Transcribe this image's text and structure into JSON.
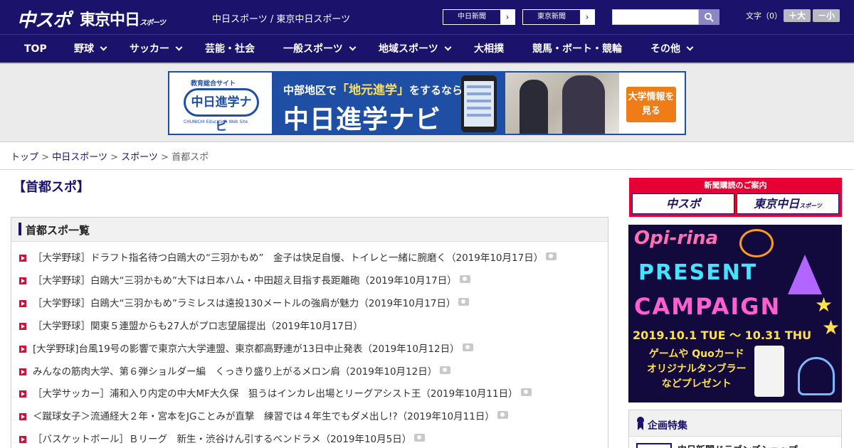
{
  "header": {
    "logo_chuspo": "中スポ",
    "logo_tokyo": "東京中日",
    "logo_tokyo_suffix": "スポーツ",
    "site_title": "中日スポーツ / 東京中日スポーツ",
    "paper_links": [
      {
        "label": "中日新聞",
        "arrow": "›"
      },
      {
        "label": "東京新聞",
        "arrow": "›"
      }
    ],
    "search": {
      "placeholder": "",
      "value": ""
    },
    "font_size_label": "文字（0）",
    "font_larger": "＋大",
    "font_smaller": "－小"
  },
  "nav": {
    "items": [
      {
        "label": "TOP",
        "has_dropdown": false
      },
      {
        "label": "野球",
        "has_dropdown": true
      },
      {
        "label": "サッカー",
        "has_dropdown": true
      },
      {
        "label": "芸能・社会",
        "has_dropdown": false
      },
      {
        "label": "一般スポーツ",
        "has_dropdown": true
      },
      {
        "label": "地域スポーツ",
        "has_dropdown": true
      },
      {
        "label": "大相撲",
        "has_dropdown": false
      },
      {
        "label": "競馬・ボート・競輪",
        "has_dropdown": false
      },
      {
        "label": "その他",
        "has_dropdown": true
      }
    ]
  },
  "banner": {
    "edu_label": "教育総合サイト",
    "logo": "中日進学ナビ",
    "logo_en": "CHUNICHI Education Web Site",
    "line1_pre": "中部地区で",
    "line1_highlight": "「地元進学」",
    "line1_post": "をするなら",
    "line2": "中日進学ナビ",
    "cta": "大学情報を見る"
  },
  "breadcrumb": {
    "items": [
      "トップ",
      "中日スポーツ",
      "スポーツ"
    ],
    "current": "首都スポ",
    "separator": ">"
  },
  "main": {
    "page_heading": "【首都スポ】",
    "list_title": "首都スポ一覧",
    "articles": [
      {
        "title": "［大学野球］ドラフト指名待つ白鴎大の“三羽かもめ”　金子は快足自慢、トイレと一緒に腕磨く（2019年10月17日）",
        "photo": true
      },
      {
        "title": "［大学野球］白鴎大“三羽かもめ”大下は日本ハム・中田超え目指す長距離砲（2019年10月17日）",
        "photo": true
      },
      {
        "title": "［大学野球］白鴎大“三羽かもめ”ラミレスは遠投130メートルの強肩が魅力（2019年10月17日）",
        "photo": true
      },
      {
        "title": "［大学野球］関東５連盟からも27人がプロ志望届提出（2019年10月17日）",
        "photo": false
      },
      {
        "title": "[大学野球]台風19号の影響で東京六大学連盟、東京都高野連が13日中止発表（2019年10月12日）",
        "photo": true
      },
      {
        "title": "みんなの筋肉大学、第６弾ショルダー編　くっきり盛り上がるメロン肩（2019年10月12日）",
        "photo": true
      },
      {
        "title": "［大学サッカー］浦和入り内定の中大MF大久保　狙うはインカレ出場とリーグアシスト王（2019年10月11日）",
        "photo": true
      },
      {
        "title": "＜蹴球女子＞流通経大２年・宮本をJGことみが直撃　練習では４年生でもダメ出し!?（2019年10月11日）",
        "photo": true
      },
      {
        "title": "［バスケットボール］Ｂリーグ　新生・渋谷けん引するベンドラメ（2019年10月5日）",
        "photo": true
      }
    ]
  },
  "sidebar": {
    "subscribe_header": "新聞購読のご案内",
    "subscribe_chuspo": "中スポ",
    "subscribe_tokyo": "東京中日",
    "subscribe_tokyo_suffix": "スポーツ",
    "promo": {
      "brand": "Opi-rina",
      "line1": "PRESENT",
      "line2": "CAMPAIGN",
      "dates": "2019.10.1 TUE 〜 10.31 THU",
      "body": "ゲームや Quoカード\nオリジナルタンブラー\nなどプレゼント"
    },
    "feature_title": "企画特集",
    "feature_item": "中日新聞ドラゴンズショップ"
  },
  "colors": {
    "brand_navy": "#1a126b",
    "accent_red": "#d0103a",
    "subscribe_red": "#e60033"
  }
}
